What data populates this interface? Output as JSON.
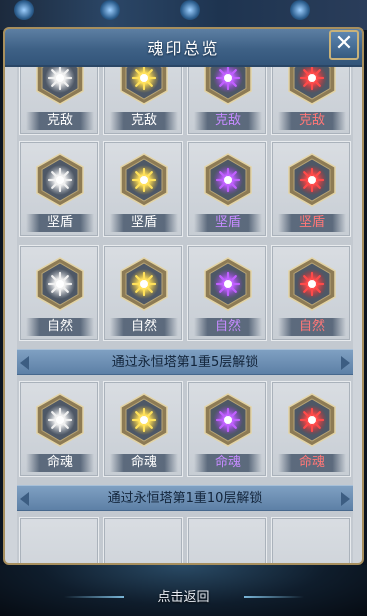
{
  "window": {
    "title": "魂印总览",
    "close_label": "✕"
  },
  "rows": [
    {
      "items": [
        {
          "label": "克敌",
          "color": "#ffffff",
          "gem": "#f0f0f0",
          "glow": "#c8ccd2"
        },
        {
          "label": "克敌",
          "color": "#ffffff",
          "gem": "#ffe15a",
          "glow": "#e2b52a"
        },
        {
          "label": "克敌",
          "color": "#c58bff",
          "gem": "#c060ff",
          "glow": "#8a3ad4"
        },
        {
          "label": "克敌",
          "color": "#ff7777",
          "gem": "#ff4a4a",
          "glow": "#c72828"
        }
      ]
    },
    {
      "items": [
        {
          "label": "坚盾",
          "color": "#ffffff",
          "gem": "#f0f0f0",
          "glow": "#c8ccd2"
        },
        {
          "label": "坚盾",
          "color": "#ffffff",
          "gem": "#ffe15a",
          "glow": "#e2b52a"
        },
        {
          "label": "坚盾",
          "color": "#c58bff",
          "gem": "#c060ff",
          "glow": "#8a3ad4"
        },
        {
          "label": "坚盾",
          "color": "#ff7777",
          "gem": "#ff4a4a",
          "glow": "#c72828"
        }
      ]
    },
    {
      "items": [
        {
          "label": "自然",
          "color": "#ffffff",
          "gem": "#f0f0f0",
          "glow": "#c8ccd2"
        },
        {
          "label": "自然",
          "color": "#ffffff",
          "gem": "#ffe15a",
          "glow": "#e2b52a"
        },
        {
          "label": "自然",
          "color": "#c58bff",
          "gem": "#c060ff",
          "glow": "#8a3ad4"
        },
        {
          "label": "自然",
          "color": "#ff7777",
          "gem": "#ff4a4a",
          "glow": "#c72828"
        }
      ]
    }
  ],
  "section1": {
    "unlock_text": "通过永恒塔第1重5层解锁",
    "items": [
      {
        "label": "命魂",
        "color": "#ffffff",
        "gem": "#f0f0f0",
        "glow": "#c8ccd2"
      },
      {
        "label": "命魂",
        "color": "#ffffff",
        "gem": "#ffe15a",
        "glow": "#e2b52a"
      },
      {
        "label": "命魂",
        "color": "#c58bff",
        "gem": "#c060ff",
        "glow": "#8a3ad4"
      },
      {
        "label": "命魂",
        "color": "#ff7777",
        "gem": "#ff4a4a",
        "glow": "#c72828"
      }
    ]
  },
  "section2": {
    "unlock_text": "通过永恒塔第1重10层解锁"
  },
  "footer": {
    "back_label": "点击返回"
  }
}
